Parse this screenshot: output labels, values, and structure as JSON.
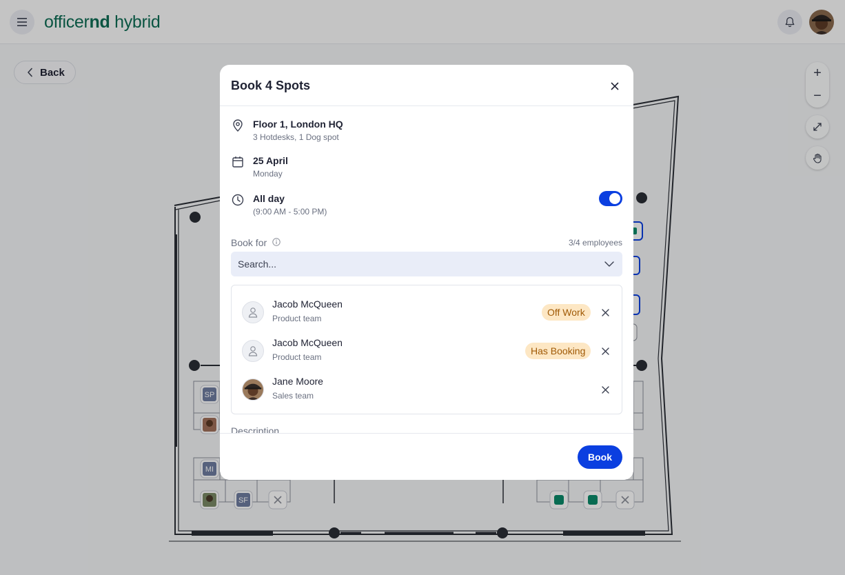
{
  "header": {
    "logo_regular": "officer",
    "logo_bold": "nd",
    "logo_suffix": " hybrid",
    "menu_icon": "menu-icon",
    "bell_icon": "bell-icon"
  },
  "toolbar": {
    "back_label": "Back"
  },
  "map_controls": {
    "zoom_in": "+",
    "zoom_out": "−"
  },
  "floorplan": {
    "seat_labels": [
      "SP",
      "MI",
      "SF"
    ]
  },
  "modal": {
    "title": "Book 4 Spots",
    "location": {
      "main": "Floor 1, London HQ",
      "sub": "3 Hotdesks, 1 Dog spot"
    },
    "date": {
      "main": "25 April",
      "sub": "Monday"
    },
    "time": {
      "main": "All day",
      "sub": "(9:00 AM - 5:00 PM)",
      "all_day": true
    },
    "book_for": {
      "label": "Book for",
      "count": "3/4 employees",
      "search_placeholder": "Search..."
    },
    "people": [
      {
        "name": "Jacob McQueen",
        "team": "Product team",
        "badge": "Off Work"
      },
      {
        "name": "Jacob McQueen",
        "team": "Product team",
        "badge": "Has Booking"
      },
      {
        "name": "Jane Moore",
        "team": "Sales team",
        "badge": ""
      }
    ],
    "description_label": "Description",
    "book_button": "Book"
  },
  "colors": {
    "brand_green": "#0f6e55",
    "primary_blue": "#0b3fe0",
    "badge_bg": "#fde7c4",
    "badge_text": "#a05a06",
    "seat_green": "#0a8a6a"
  }
}
